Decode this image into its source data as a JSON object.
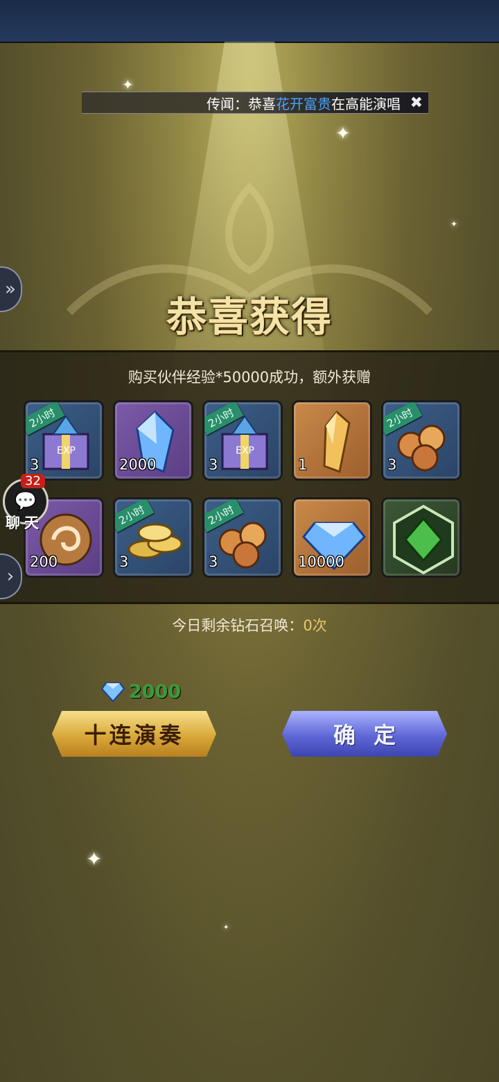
{
  "rumor": {
    "prefix": "传闻：恭喜",
    "player": "花开富贵",
    "suffix": "在高能演唱",
    "close_icon": "close-icon"
  },
  "title": "恭喜获得",
  "subtitle": "购买伙伴经验*50000成功，额外获赠",
  "items": [
    {
      "icon": "exp-gift-box-icon",
      "qty": "3",
      "rarity": "blue",
      "ribbon": "2小时"
    },
    {
      "icon": "blue-crystal-icon",
      "qty": "2000",
      "rarity": "purple",
      "ribbon": ""
    },
    {
      "icon": "exp-gift-box-icon",
      "qty": "3",
      "rarity": "blue",
      "ribbon": "2小时"
    },
    {
      "icon": "gold-crystal-icon",
      "qty": "1",
      "rarity": "orange",
      "ribbon": ""
    },
    {
      "icon": "rose-bundle-icon",
      "qty": "3",
      "rarity": "blue",
      "ribbon": "2小时"
    },
    {
      "icon": "swirl-orb-icon",
      "qty": "200",
      "rarity": "purple",
      "ribbon": ""
    },
    {
      "icon": "gold-coins-icon",
      "qty": "3",
      "rarity": "blue",
      "ribbon": "2小时"
    },
    {
      "icon": "rose-bundle-icon",
      "qty": "3",
      "rarity": "blue",
      "ribbon": "2小时"
    },
    {
      "icon": "diamond-icon",
      "qty": "10000",
      "rarity": "orange",
      "ribbon": ""
    },
    {
      "icon": "green-emblem-icon",
      "qty": "",
      "rarity": "green",
      "ribbon": ""
    }
  ],
  "chat": {
    "badge": "32",
    "label": "聊天"
  },
  "remaining": {
    "label": "今日剩余钻石召唤：",
    "count": "0次"
  },
  "cost": {
    "amount": "2000",
    "icon": "diamond-icon"
  },
  "buttons": {
    "ten_pull": "十连演奏",
    "confirm": "确定"
  },
  "colors": {
    "highlight": "#4aa3ff",
    "cost_green": "#3b9a3b",
    "gold_button": "#d9a93a",
    "blue_button": "#5e67d6"
  }
}
